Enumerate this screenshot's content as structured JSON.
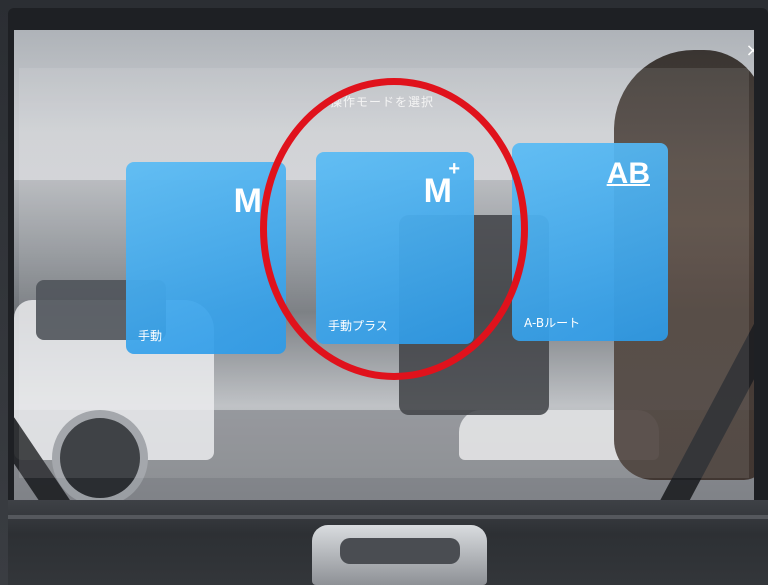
{
  "dialog": {
    "title": "操作モードを選択",
    "close_icon": "close-icon",
    "close_glyph": "×"
  },
  "modes": [
    {
      "id": "manual",
      "glyph": "M",
      "label": "手動"
    },
    {
      "id": "manual-plus",
      "glyph": "M",
      "superscript": "+",
      "label": "手動プラス"
    },
    {
      "id": "ab-route",
      "glyph": "AB",
      "label": "A-Bルート"
    }
  ],
  "colors": {
    "tile": "#3aa6ee",
    "highlight_circle": "#e0121c"
  }
}
